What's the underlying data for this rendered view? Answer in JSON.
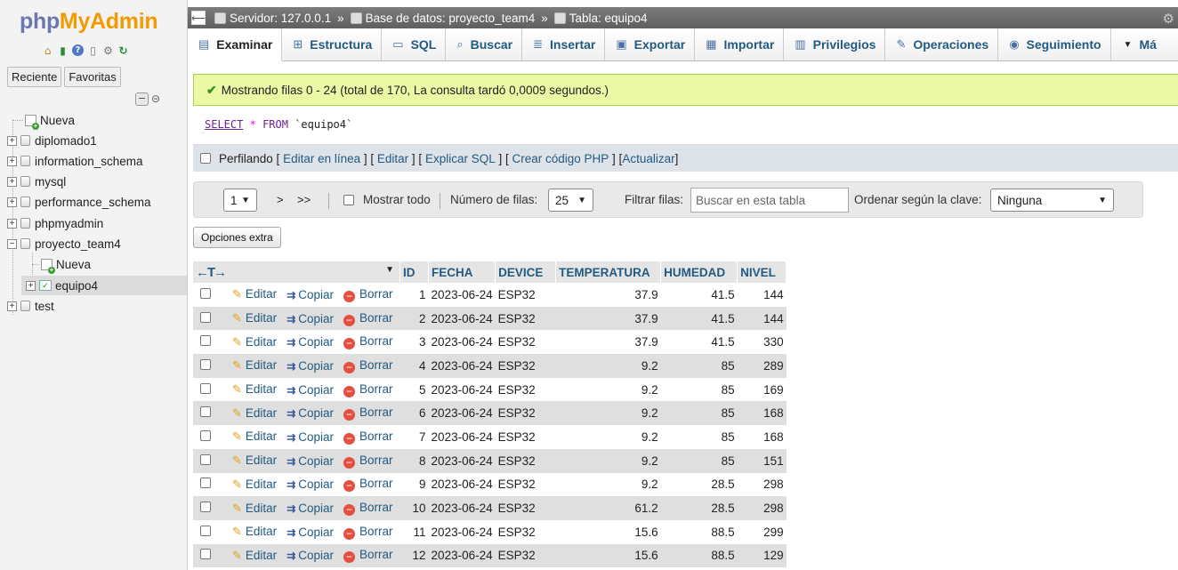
{
  "sidebar": {
    "logo_php": "php",
    "logo_myadmin": "MyAdmin",
    "tab_recent": "Reciente",
    "tab_favorites": "Favoritas",
    "tree": [
      {
        "label": "Nueva",
        "kind": "new"
      },
      {
        "label": "diplomado1",
        "kind": "db"
      },
      {
        "label": "information_schema",
        "kind": "db"
      },
      {
        "label": "mysql",
        "kind": "db"
      },
      {
        "label": "performance_schema",
        "kind": "db"
      },
      {
        "label": "phpmyadmin",
        "kind": "db"
      },
      {
        "label": "proyecto_team4",
        "kind": "db-open"
      },
      {
        "label": "Nueva",
        "kind": "new-child"
      },
      {
        "label": "equipo4",
        "kind": "table-child"
      },
      {
        "label": "test",
        "kind": "db"
      }
    ]
  },
  "breadcrumb": {
    "server": "Servidor: 127.0.0.1",
    "database": "Base de datos: proyecto_team4",
    "table": "Tabla: equipo4",
    "sep": "»"
  },
  "tabs": [
    {
      "label": "Examinar",
      "icon": "browse-icon"
    },
    {
      "label": "Estructura",
      "icon": "structure-icon"
    },
    {
      "label": "SQL",
      "icon": "sql-icon"
    },
    {
      "label": "Buscar",
      "icon": "search-icon"
    },
    {
      "label": "Insertar",
      "icon": "insert-icon"
    },
    {
      "label": "Exportar",
      "icon": "export-icon"
    },
    {
      "label": "Importar",
      "icon": "import-icon"
    },
    {
      "label": "Privilegios",
      "icon": "privileges-icon"
    },
    {
      "label": "Operaciones",
      "icon": "operations-icon"
    },
    {
      "label": "Seguimiento",
      "icon": "tracking-icon"
    },
    {
      "label": "Má",
      "icon": "more-icon"
    }
  ],
  "message": "Mostrando filas 0 - 24 (total de 170, La consulta tardó 0,0009 segundos.)",
  "sql": {
    "select": "SELECT",
    "star": "*",
    "from": "FROM",
    "table": "`equipo4`"
  },
  "profiling": {
    "label": "Perfilando",
    "links": [
      "Editar en línea",
      "Editar",
      "Explicar SQL",
      "Crear código PHP",
      "Actualizar"
    ]
  },
  "nav": {
    "page": "1",
    "next": ">",
    "last": ">>",
    "show_all": "Mostrar todo",
    "rows_label": "Número de filas:",
    "rows_value": "25",
    "filter_label": "Filtrar filas:",
    "filter_placeholder": "Buscar en esta tabla",
    "sort_label": "Ordenar según la clave:",
    "sort_value": "Ninguna"
  },
  "extra_options": "Opciones extra",
  "table": {
    "columns": [
      "ID",
      "FECHA",
      "DEVICE",
      "TEMPERATURA",
      "HUMEDAD",
      "NIVEL"
    ],
    "actions": {
      "edit": "Editar",
      "copy": "Copiar",
      "delete": "Borrar"
    },
    "rows": [
      [
        "1",
        "2023-06-24",
        "ESP32",
        "37.9",
        "41.5",
        "144"
      ],
      [
        "2",
        "2023-06-24",
        "ESP32",
        "37.9",
        "41.5",
        "144"
      ],
      [
        "3",
        "2023-06-24",
        "ESP32",
        "37.9",
        "41.5",
        "330"
      ],
      [
        "4",
        "2023-06-24",
        "ESP32",
        "9.2",
        "85",
        "289"
      ],
      [
        "5",
        "2023-06-24",
        "ESP32",
        "9.2",
        "85",
        "169"
      ],
      [
        "6",
        "2023-06-24",
        "ESP32",
        "9.2",
        "85",
        "168"
      ],
      [
        "7",
        "2023-06-24",
        "ESP32",
        "9.2",
        "85",
        "168"
      ],
      [
        "8",
        "2023-06-24",
        "ESP32",
        "9.2",
        "85",
        "151"
      ],
      [
        "9",
        "2023-06-24",
        "ESP32",
        "9.2",
        "28.5",
        "298"
      ],
      [
        "10",
        "2023-06-24",
        "ESP32",
        "61.2",
        "28.5",
        "298"
      ],
      [
        "11",
        "2023-06-24",
        "ESP32",
        "15.6",
        "88.5",
        "299"
      ],
      [
        "12",
        "2023-06-24",
        "ESP32",
        "15.6",
        "88.5",
        "129"
      ]
    ]
  },
  "colors": {
    "link": "#235a81",
    "success_bg": "#ebf8a4",
    "stripe": "#dfdfdf"
  }
}
